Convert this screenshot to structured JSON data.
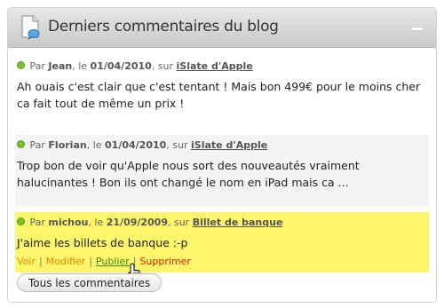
{
  "widget": {
    "title": "Derniers commentaires du blog",
    "icon": "document-comment-icon",
    "collapse_icon": "minimize-icon"
  },
  "comments": [
    {
      "prefix": "Par",
      "author": "Jean",
      "date_prefix": ", le",
      "date": "01/04/2010",
      "post_prefix": ", sur",
      "post": "iSlate d'Apple",
      "text": "Ah ouais c'est clair que c'est tentant ! Mais bon 499€ pour le moins cher ca fait tout de même un prix !",
      "status_color": "#7fc231"
    },
    {
      "prefix": "Par",
      "author": "Florian",
      "date_prefix": ", le",
      "date": "01/04/2010",
      "post_prefix": ", sur",
      "post": "iSlate d'Apple",
      "text": "Trop bon de voir qu'Apple nous sort des nouveautés vraiment halucinantes ! Bon ils ont changé le nom en iPad mais ca ...",
      "status_color": "#7fc231"
    },
    {
      "prefix": "Par",
      "author": "michou",
      "date_prefix": ", le",
      "date": "21/09/2009",
      "post_prefix": ", sur",
      "post": "Billet de banque",
      "text": "J'aime les billets de banque :-p",
      "status_color": "#7fc231",
      "highlight_color": "#fdf56a",
      "actions": {
        "view": "Voir",
        "edit": "Modifier",
        "publish": "Publier",
        "delete": "Supprimer",
        "separator": "|"
      }
    }
  ],
  "footer": {
    "all_comments_label": "Tous les commentaires"
  }
}
